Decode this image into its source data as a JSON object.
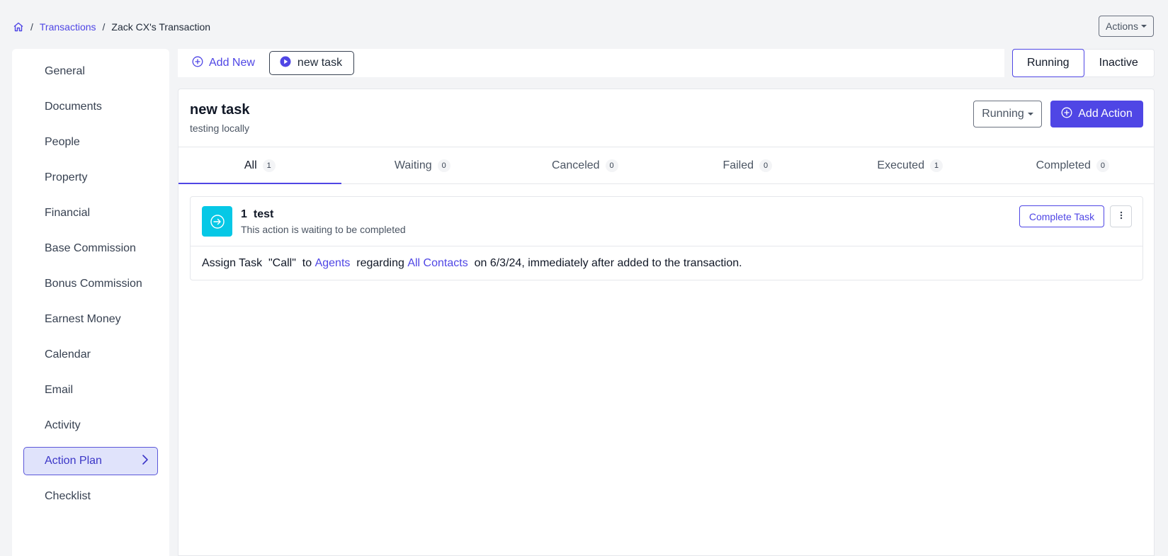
{
  "breadcrumb": {
    "home_icon": "home-icon",
    "separator": "/",
    "transactions": "Transactions",
    "current": "Zack CX's Transaction"
  },
  "header": {
    "actions_label": "Actions"
  },
  "sidebar": {
    "items": [
      {
        "label": "General"
      },
      {
        "label": "Documents"
      },
      {
        "label": "People"
      },
      {
        "label": "Property"
      },
      {
        "label": "Financial"
      },
      {
        "label": "Base Commission"
      },
      {
        "label": "Bonus Commission"
      },
      {
        "label": "Earnest Money"
      },
      {
        "label": "Calendar"
      },
      {
        "label": "Email"
      },
      {
        "label": "Activity"
      },
      {
        "label": "Action Plan",
        "active": true
      },
      {
        "label": "Checklist"
      }
    ]
  },
  "topbar": {
    "add_new_label": "Add New",
    "task_chip_label": "new task",
    "status_options": [
      "Running",
      "Inactive"
    ],
    "selected_status": "Running"
  },
  "plan": {
    "title": "new task",
    "subtitle": "testing locally",
    "running_label": "Running",
    "add_action_label": "Add Action"
  },
  "tabs": [
    {
      "label": "All",
      "count": "1"
    },
    {
      "label": "Waiting",
      "count": "0"
    },
    {
      "label": "Canceled",
      "count": "0"
    },
    {
      "label": "Failed",
      "count": "0"
    },
    {
      "label": "Executed",
      "count": "1"
    },
    {
      "label": "Completed",
      "count": "0"
    }
  ],
  "action": {
    "number": "1",
    "title": "test",
    "status_text": "This action is waiting to be completed",
    "complete_label": "Complete Task",
    "desc_prefix": "Assign Task  \"Call\"  to ",
    "assignee": "Agents",
    "desc_mid": "  regarding ",
    "regarding": "All Contacts",
    "desc_suffix": "  on 6/3/24, immediately after added to the transaction."
  },
  "colors": {
    "accent": "#4f46e5",
    "action_icon_bg": "#06c8e6",
    "page_bg": "#f3f4f6"
  }
}
